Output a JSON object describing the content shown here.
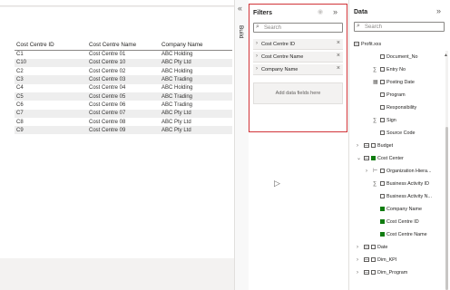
{
  "table": {
    "headers": [
      "Cost Centre ID",
      "Cost Centre Name",
      "Company Name"
    ],
    "rows": [
      [
        "C1",
        "Cost Centre 01",
        "ABC Holding"
      ],
      [
        "C10",
        "Cost Centre 10",
        "ABC Pty Ltd"
      ],
      [
        "C2",
        "Cost Centre 02",
        "ABC Holding"
      ],
      [
        "C3",
        "Cost Centre 03",
        "ABC Trading"
      ],
      [
        "C4",
        "Cost Centre 04",
        "ABC Holding"
      ],
      [
        "C5",
        "Cost Centre 05",
        "ABC Trading"
      ],
      [
        "C6",
        "Cost Centre 06",
        "ABC Trading"
      ],
      [
        "C7",
        "Cost Centre 07",
        "ABC Pty Ltd"
      ],
      [
        "C8",
        "Cost Centre 08",
        "ABC Pty Ltd"
      ],
      [
        "C9",
        "Cost Centre 09",
        "ABC Pty Ltd"
      ]
    ]
  },
  "viz_strip": {
    "label": "Build"
  },
  "filters": {
    "title": "Filters",
    "search_placeholder": "Search",
    "cards": [
      "Cost Centre ID",
      "Cost Centre Name",
      "Company Name"
    ],
    "add_fields": "Add data fields here"
  },
  "data": {
    "title": "Data",
    "search_placeholder": "Search",
    "items": [
      {
        "text": "Profit.xxs",
        "kind": "table-open"
      },
      {
        "text": "Document_No",
        "kind": "field"
      },
      {
        "text": "Entry No",
        "kind": "measure"
      },
      {
        "text": "Posting Date",
        "kind": "date"
      },
      {
        "text": "Program",
        "kind": "field"
      },
      {
        "text": "Responsibility",
        "kind": "field"
      },
      {
        "text": "Sign",
        "kind": "measure"
      },
      {
        "text": "Source Code",
        "kind": "field"
      },
      {
        "text": "Budget",
        "kind": "table-closed"
      },
      {
        "text": "Cost Center",
        "kind": "table-open-checked"
      },
      {
        "text": "Organization Hiera...",
        "kind": "hierarchy"
      },
      {
        "text": "Business Activity ID",
        "kind": "measure"
      },
      {
        "text": "Business Activity N...",
        "kind": "field"
      },
      {
        "text": "Company Name",
        "kind": "field-checked"
      },
      {
        "text": "Cost Centre ID",
        "kind": "field-checked"
      },
      {
        "text": "Cost Centre Name",
        "kind": "field-checked"
      },
      {
        "text": "Date",
        "kind": "table-closed"
      },
      {
        "text": "Dim_KPI",
        "kind": "table-closed"
      },
      {
        "text": "Dim_Program",
        "kind": "table-closed"
      }
    ]
  },
  "colors": {
    "accent_red": "#d13438",
    "check_green": "#107c10"
  }
}
